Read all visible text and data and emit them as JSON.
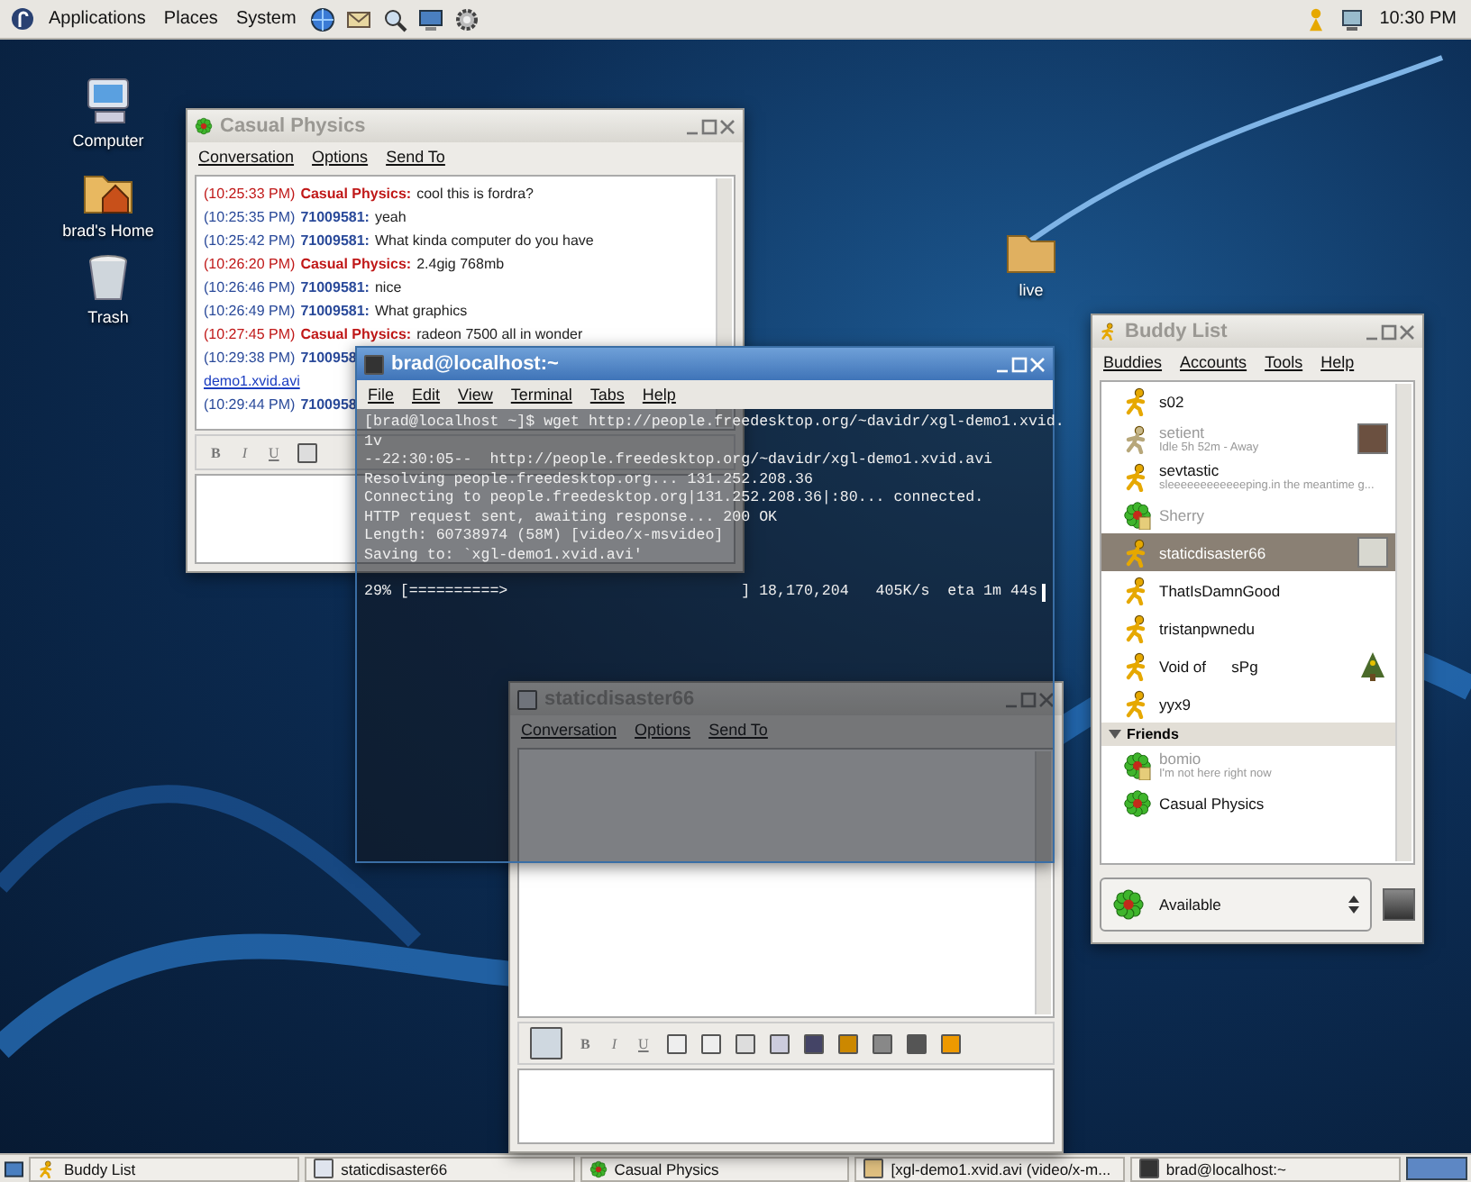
{
  "top_panel": {
    "menus": [
      "Applications",
      "Places",
      "System"
    ],
    "clock": "10:30 PM"
  },
  "desktop_icons": [
    {
      "label": "Computer",
      "kind": "computer"
    },
    {
      "label": "brad's Home",
      "kind": "home"
    },
    {
      "label": "Trash",
      "kind": "trash"
    },
    {
      "label": "live",
      "kind": "folder"
    }
  ],
  "chat_window": {
    "title": "Casual Physics",
    "focused": false,
    "menus": [
      "Conversation",
      "Options",
      "Send To"
    ],
    "messages": [
      {
        "kind": "message",
        "time": "(10:25:33 PM)",
        "sender": "Casual Physics:",
        "text": "cool this is fordra?",
        "from_buddy": true
      },
      {
        "kind": "message",
        "time": "(10:25:35 PM)",
        "sender": "71009581:",
        "text": "yeah",
        "from_buddy": false
      },
      {
        "kind": "message",
        "time": "(10:25:42 PM)",
        "sender": "71009581:",
        "text": "What kinda computer do you have",
        "from_buddy": false
      },
      {
        "kind": "message",
        "time": "(10:26:20 PM)",
        "sender": "Casual Physics:",
        "text": "2.4gig 768mb",
        "from_buddy": true
      },
      {
        "kind": "message",
        "time": "(10:26:46 PM)",
        "sender": "71009581:",
        "text": "nice",
        "from_buddy": false
      },
      {
        "kind": "message",
        "time": "(10:26:49 PM)",
        "sender": "71009581:",
        "text": "What graphics",
        "from_buddy": false
      },
      {
        "kind": "message",
        "time": "(10:27:45 PM)",
        "sender": "Casual Physics:",
        "text": "radeon 7500 all in wonder",
        "from_buddy": true
      },
      {
        "kind": "message",
        "time": "(10:29:38 PM)",
        "sender": "7100958",
        "from_buddy": false
      },
      {
        "kind": "link",
        "text": "demo1.xvid.avi"
      },
      {
        "kind": "message",
        "time": "(10:29:44 PM)",
        "sender": "7100958",
        "from_buddy": false
      }
    ],
    "format_buttons": [
      "B",
      "I",
      "U"
    ]
  },
  "terminal": {
    "title": "brad@localhost:~",
    "focused": true,
    "menus": [
      "File",
      "Edit",
      "View",
      "Terminal",
      "Tabs",
      "Help"
    ],
    "lines": [
      "[brad@localhost ~]$ wget http://people.freedesktop.org/~davidr/xgl-demo1.xvid.",
      "1v",
      "--22:30:05--  http://people.freedesktop.org/~davidr/xgl-demo1.xvid.avi",
      "Resolving people.freedesktop.org... 131.252.208.36",
      "Connecting to people.freedesktop.org|131.252.208.36|:80... connected.",
      "HTTP request sent, awaiting response... 200 OK",
      "Length: 60738974 (58M) [video/x-msvideo]",
      "Saving to: `xgl-demo1.xvid.avi'"
    ],
    "progress_line": "29% [==========>                          ] 18,170,204   405K/s  eta 1m 44s"
  },
  "conversation_window": {
    "title": "staticdisaster66",
    "focused": false,
    "menus": [
      "Conversation",
      "Options",
      "Send To"
    ],
    "format_buttons": [
      "B",
      "I",
      "U"
    ]
  },
  "buddy_list": {
    "title": "Buddy List",
    "focused": false,
    "menus": [
      "Buddies",
      "Accounts",
      "Tools",
      "Help"
    ],
    "groups": [
      {
        "buddies": [
          {
            "name": "s02",
            "kind": "aim",
            "away": false,
            "selected": false
          },
          {
            "name": "setient",
            "status": "Idle 5h 52m - Away",
            "kind": "aim",
            "away": true,
            "selected": false,
            "avatar": {
              "kind": "photo"
            }
          },
          {
            "name": "sevtastic",
            "status": "sleeeeeeeeeeeeping.in the meantime g...",
            "kind": "aim",
            "away": false,
            "selected": false
          },
          {
            "name": "Sherry",
            "kind": "icq",
            "away": true,
            "selected": false
          },
          {
            "name": "staticdisaster66",
            "kind": "aim",
            "away": false,
            "selected": true,
            "avatar": {
              "kind": "computer"
            }
          },
          {
            "name": "ThatIsDamnGood",
            "kind": "aim",
            "away": false,
            "selected": false
          },
          {
            "name": "tristanpwnedu",
            "kind": "aim",
            "away": false,
            "selected": false
          },
          {
            "name": "Void of      sPg",
            "kind": "aim",
            "away": false,
            "selected": false,
            "avatar": {
              "kind": "tree"
            }
          },
          {
            "name": "yyx9",
            "kind": "aim",
            "away": false,
            "selected": false
          }
        ]
      },
      {
        "name": "Friends",
        "expanded": true,
        "buddies": [
          {
            "name": "bomio",
            "status": "I'm not here right now",
            "kind": "icq",
            "away": true,
            "selected": false
          },
          {
            "name": "Casual Physics",
            "kind": "icq",
            "away": false,
            "selected": false
          }
        ]
      }
    ],
    "status": "Available"
  },
  "taskbar": [
    {
      "label": "Buddy List",
      "kind": "buddy"
    },
    {
      "label": "staticdisaster66",
      "kind": "chat"
    },
    {
      "label": "Casual Physics",
      "kind": "icq"
    },
    {
      "label": "[xgl-demo1.xvid.avi (video/x-m...",
      "kind": "download"
    },
    {
      "label": "brad@localhost:~",
      "kind": "terminal"
    }
  ]
}
